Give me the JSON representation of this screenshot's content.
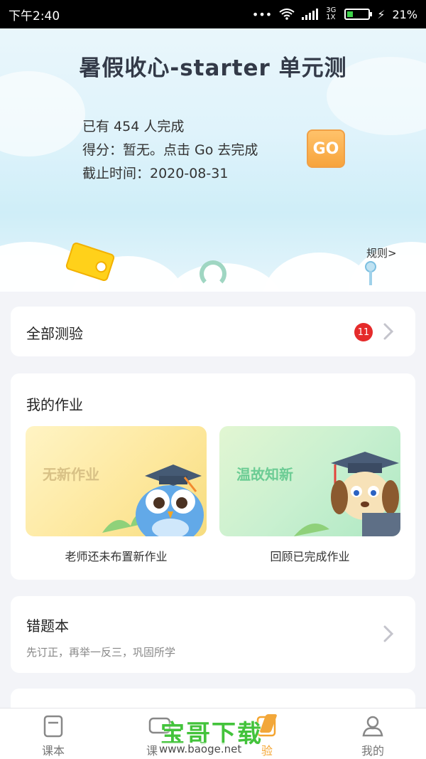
{
  "status_bar": {
    "time": "下午2:40",
    "signal": "3G 1X",
    "dots": "•••",
    "battery": "21%"
  },
  "hero": {
    "title": "暑假收心-starter 单元测",
    "completed": "已有 454 人完成",
    "score": "得分：暂无。点击 Go 去完成",
    "deadline": "截止时间：2020-08-31",
    "go_label": "GO",
    "rules_label": "规则>"
  },
  "all_tests": {
    "label": "全部测验",
    "badge": "11"
  },
  "homework": {
    "title": "我的作业",
    "tiles": [
      {
        "title": "无新作业",
        "caption": "老师还未布置新作业",
        "mascot": "owl-graduate-icon"
      },
      {
        "title": "温故知新",
        "caption": "回顾已完成作业",
        "mascot": "dog-graduate-icon"
      }
    ]
  },
  "wrong_book": {
    "title": "错题本",
    "subtitle": "先订正，再举一反三，巩固所学"
  },
  "tabbar": {
    "items": [
      {
        "label": "课本",
        "icon": "book-icon"
      },
      {
        "label": "课",
        "icon": "chat-icon"
      },
      {
        "label": "验",
        "icon": "test-icon",
        "active": true
      },
      {
        "label": "我的",
        "icon": "profile-icon"
      }
    ]
  },
  "watermark": {
    "title": "宝哥下载",
    "url": "www.baoge.net"
  },
  "colors": {
    "accent": "#f4a42f",
    "badge": "#e52b2b",
    "go": "#f7a43c",
    "watermark": "#43c33b"
  }
}
